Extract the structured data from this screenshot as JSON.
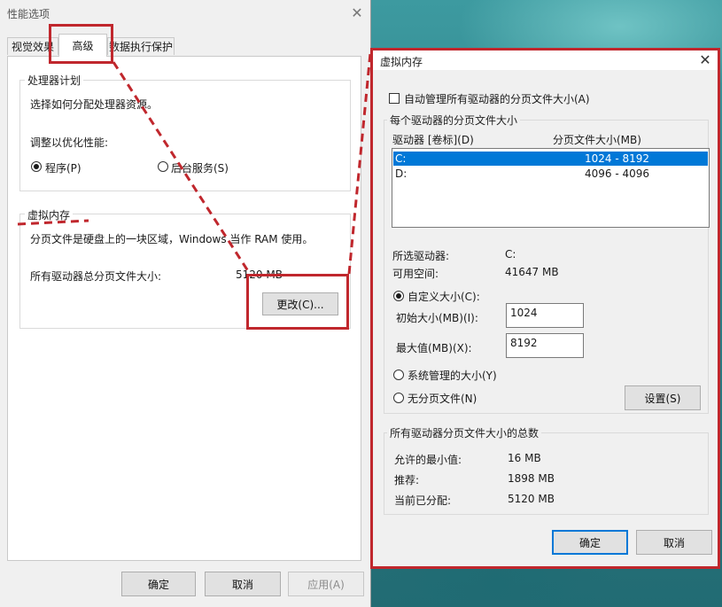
{
  "perf_dialog": {
    "title": "性能选项",
    "tabs": [
      "视觉效果",
      "高级",
      "数据执行保护"
    ],
    "cpu_group": {
      "legend": "处理器计划",
      "desc": "选择如何分配处理器资源。",
      "adjust_label": "调整以优化性能:",
      "opt_programs": "程序(P)",
      "opt_background": "后台服务(S)"
    },
    "vm_group": {
      "legend": "虚拟内存",
      "desc": "分页文件是硬盘上的一块区域，Windows 当作 RAM 使用。",
      "total_label": "所有驱动器总分页文件大小:",
      "total_value": "5120 MB",
      "change_button": "更改(C)..."
    },
    "buttons": {
      "ok": "确定",
      "cancel": "取消",
      "apply": "应用(A)"
    }
  },
  "vm_dialog": {
    "title": "虚拟内存",
    "auto_manage": "自动管理所有驱动器的分页文件大小(A)",
    "per_drive_legend": "每个驱动器的分页文件大小",
    "col_drive": "驱动器 [卷标](D)",
    "col_size": "分页文件大小(MB)",
    "drives": [
      {
        "drive": "C:",
        "size": "1024 - 8192"
      },
      {
        "drive": "D:",
        "size": "4096 - 4096"
      }
    ],
    "selected_drive_label": "所选驱动器:",
    "selected_drive_value": "C:",
    "free_space_label": "可用空间:",
    "free_space_value": "41647 MB",
    "custom_size": "自定义大小(C):",
    "initial_label": "初始大小(MB)(I):",
    "initial_value": "1024",
    "max_label": "最大值(MB)(X):",
    "max_value": "8192",
    "system_managed": "系统管理的大小(Y)",
    "no_paging": "无分页文件(N)",
    "set_button": "设置(S)",
    "totals_legend": "所有驱动器分页文件大小的总数",
    "min_label": "允许的最小值:",
    "min_value": "16 MB",
    "recommended_label": "推荐:",
    "recommended_value": "1898 MB",
    "allocated_label": "当前已分配:",
    "allocated_value": "5120 MB",
    "ok": "确定",
    "cancel": "取消"
  },
  "colors": {
    "highlight": "#c0272d",
    "selection": "#0078d7",
    "desktop": "#2f7f86"
  }
}
